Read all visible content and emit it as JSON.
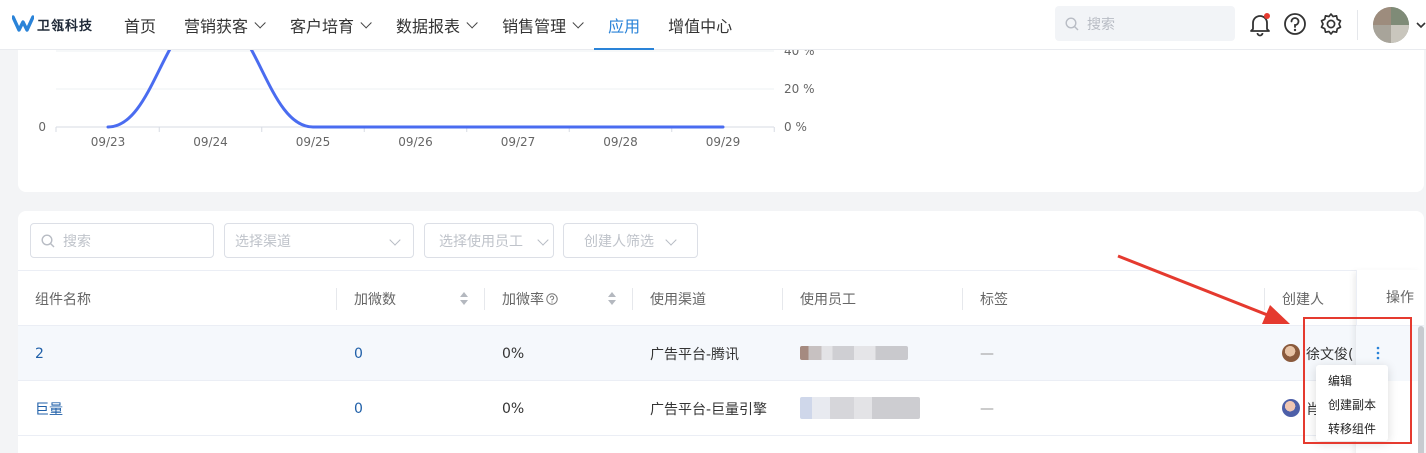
{
  "brand": {
    "name": "卫瓴科技"
  },
  "nav": {
    "items": [
      {
        "label": "首页",
        "has_menu": false
      },
      {
        "label": "营销获客",
        "has_menu": true
      },
      {
        "label": "客户培育",
        "has_menu": true
      },
      {
        "label": "数据报表",
        "has_menu": true
      },
      {
        "label": "销售管理",
        "has_menu": true
      },
      {
        "label": "应用",
        "has_menu": false,
        "active": true
      },
      {
        "label": "增值中心",
        "has_menu": false
      }
    ],
    "search_placeholder": "搜索",
    "icons": [
      "bell-icon",
      "help-icon",
      "gear-icon",
      "avatar",
      "chevron-down-icon"
    ]
  },
  "chart": {
    "type": "line",
    "left_axis": {
      "ticks": [
        "0"
      ]
    },
    "right_axis": {
      "ticks": [
        "40 %",
        "20 %",
        "0 %"
      ],
      "range": [
        0,
        40
      ]
    },
    "categories": [
      "09/23",
      "09/24",
      "09/25",
      "09/26",
      "09/27",
      "09/28",
      "09/29"
    ]
  },
  "chart_data": {
    "type": "line",
    "categories": [
      "09/23",
      "09/24",
      "09/25",
      "09/26",
      "09/27",
      "09/28",
      "09/29"
    ],
    "series": [
      {
        "values": [
          0,
          60,
          0,
          0,
          0,
          0,
          0
        ]
      }
    ],
    "y_right_ticks": [
      "0 %",
      "20 %",
      "40 %"
    ],
    "ylim_right": [
      0,
      40
    ],
    "grid": true,
    "color": "#4a6cf0"
  },
  "filters": {
    "search_placeholder": "搜索",
    "channel_placeholder": "选择渠道",
    "employee_placeholder": "选择使用员工",
    "creator_placeholder": "创建人筛选"
  },
  "table": {
    "columns": [
      "组件名称",
      "加微数",
      "加微率",
      "使用渠道",
      "使用员工",
      "标签",
      "创建人",
      "操作"
    ],
    "rows": [
      {
        "name": "2",
        "count": "0",
        "rate": "0%",
        "channel": "广告平台-腾讯",
        "tags": "—",
        "creator": "徐文俊("
      },
      {
        "name": "巨量",
        "count": "0",
        "rate": "0%",
        "channel": "广告平台-巨量引擎",
        "tags": "—",
        "creator": "肖"
      }
    ]
  },
  "menu": {
    "items": [
      "编辑",
      "创建副本",
      "转移组件"
    ]
  },
  "colors": {
    "accent": "#2a83d8",
    "line": "#4a6cf0",
    "annotation": "#e53a2f"
  }
}
